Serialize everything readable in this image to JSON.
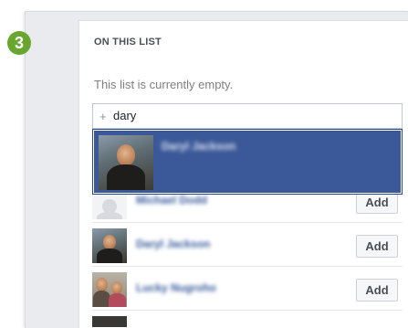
{
  "step_badge": "3",
  "section_title": "ON THIS LIST",
  "empty_message": "This list is currently empty.",
  "search": {
    "icon": "plus-icon",
    "value": "dary"
  },
  "suggestion": {
    "name": "Daryl Jackson"
  },
  "friends": [
    {
      "name": "Michael Dodd",
      "add_label": "Add"
    },
    {
      "name": "Daryl Jackson",
      "add_label": "Add"
    },
    {
      "name": "Lucky Nugroho",
      "add_label": "Add"
    }
  ],
  "colors": {
    "badge_green": "#68a630",
    "highlight_blue": "#3b5998",
    "link_blue": "#365899"
  }
}
